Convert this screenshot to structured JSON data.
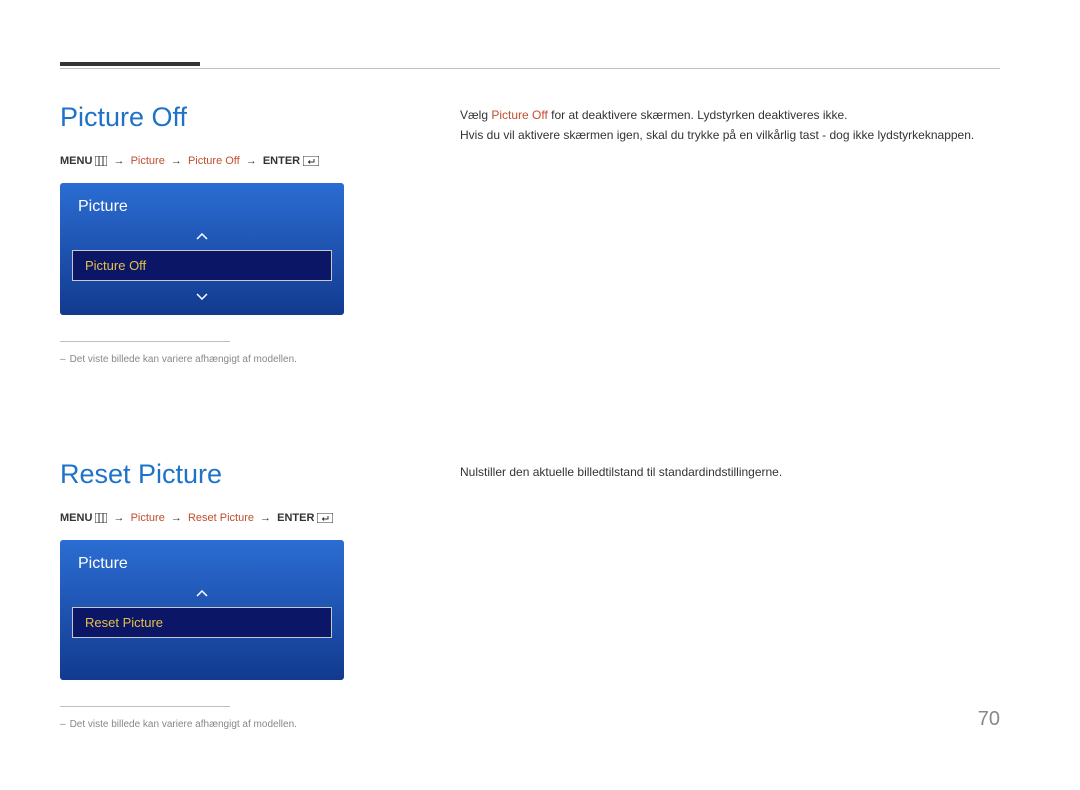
{
  "page_number": "70",
  "section1": {
    "heading": "Picture Off",
    "path": {
      "menu": "MENU",
      "step1": "Picture",
      "step2": "Picture Off",
      "enter": "ENTER"
    },
    "osd_title": "Picture",
    "osd_item": "Picture Off",
    "footnote": "Det viste billede kan variere afhængigt af modellen.",
    "body_pre": "Vælg ",
    "body_hl": "Picture Off",
    "body_post": " for at deaktivere skærmen. Lydstyrken deaktiveres ikke.",
    "body_line2": "Hvis du vil aktivere skærmen igen, skal du trykke på en vilkårlig tast - dog ikke lydstyrkeknappen."
  },
  "section2": {
    "heading": "Reset Picture",
    "path": {
      "menu": "MENU",
      "step1": "Picture",
      "step2": "Reset Picture",
      "enter": "ENTER"
    },
    "osd_title": "Picture",
    "osd_item": "Reset Picture",
    "footnote": "Det viste billede kan variere afhængigt af modellen.",
    "body": "Nulstiller den aktuelle billedtilstand til standardindstillingerne."
  }
}
